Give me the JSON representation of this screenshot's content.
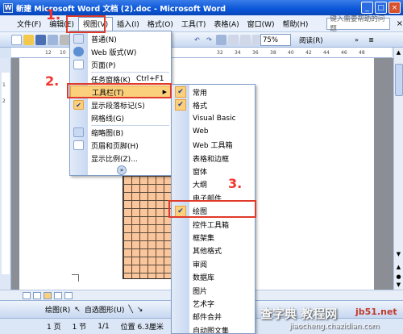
{
  "window": {
    "title": "新建 Microsoft Word 文档 (2).doc - Microsoft Word",
    "icon_letter": "W"
  },
  "menubar": {
    "items": [
      "文件(F)",
      "编辑(E)",
      "视图(V)",
      "插入(I)",
      "格式(O)",
      "工具(T)",
      "表格(A)",
      "窗口(W)",
      "帮助(H)"
    ],
    "help_placeholder": "键入需要帮助的问题",
    "close": "×"
  },
  "toolbar": {
    "zoom": "75%",
    "read": "阅读(R)"
  },
  "ruler": {
    "ticks": [
      "12",
      "10",
      "32",
      "34",
      "36",
      "38",
      "40",
      "42",
      "44",
      "46",
      "48"
    ]
  },
  "vruler": {
    "ticks": [
      "1",
      "2"
    ]
  },
  "view_menu": {
    "items": [
      {
        "label": "普通(N)",
        "icon": "normal-view-icon"
      },
      {
        "label": "Web 版式(W)",
        "icon": "web-layout-icon"
      },
      {
        "label": "页面(P)",
        "icon": "page-layout-icon"
      },
      {
        "label": "任务窗格(K)",
        "shortcut": "Ctrl+F1"
      },
      {
        "label": "工具栏(T)",
        "highlighted": true
      },
      {
        "label": "显示段落标记(S)",
        "checked": true
      },
      {
        "label": "网格线(G)"
      },
      {
        "label": "缩略图(B)"
      },
      {
        "label": "页眉和页脚(H)"
      },
      {
        "label": "显示比例(Z)..."
      }
    ]
  },
  "toolbars_submenu": {
    "items": [
      {
        "label": "常用",
        "checked": true
      },
      {
        "label": "格式",
        "checked": true
      },
      {
        "label": "Visual Basic"
      },
      {
        "label": "Web"
      },
      {
        "label": "Web 工具箱"
      },
      {
        "label": "表格和边框"
      },
      {
        "label": "窗体"
      },
      {
        "label": "大纲"
      },
      {
        "label": "电子邮件"
      },
      {
        "label": "绘图",
        "checked": true
      },
      {
        "label": "控件工具箱"
      },
      {
        "label": "框架集"
      },
      {
        "label": "其他格式"
      },
      {
        "label": "审阅"
      },
      {
        "label": "数据库"
      },
      {
        "label": "图片"
      },
      {
        "label": "艺术字"
      },
      {
        "label": "邮件合并"
      },
      {
        "label": "自动图文集"
      }
    ]
  },
  "steps": {
    "one": "1.",
    "two": "2.",
    "three": "3."
  },
  "drawbar": {
    "draw": "绘图(R)",
    "autoshapes": "自选图形(U)"
  },
  "status": {
    "page": "1 页",
    "section": "1 节",
    "pages": "1/1",
    "position": "位置 6.3厘米"
  },
  "watermark": {
    "main": "查字典 教程网",
    "url": "jiaocheng.chazidian.com",
    "site": "jb51.net"
  },
  "colors": {
    "grid_fill": "#fbc69c",
    "annotation_red": "#e03a2a",
    "title_blue": "#0a56d8",
    "menu_highlight": "#fbd07d"
  }
}
